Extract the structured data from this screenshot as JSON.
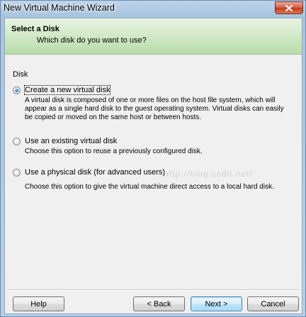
{
  "window": {
    "title": "New Virtual Machine Wizard"
  },
  "header": {
    "title": "Select a Disk",
    "subtitle": "Which disk do you want to use?"
  },
  "disk_group": {
    "label": "Disk",
    "selected": "create_new",
    "options": [
      {
        "key": "create_new",
        "label": "Create a new virtual disk",
        "description": "A virtual disk is composed of one or more files on the host file system, which will appear as a single hard disk to the guest operating system. Virtual disks can easily be copied or moved on the same host or between hosts.",
        "checked": true
      },
      {
        "key": "use_existing",
        "label": "Use an existing virtual disk",
        "description": "Choose this option to reuse a previously configured disk.",
        "checked": false
      },
      {
        "key": "use_physical",
        "label": "Use a physical disk (for advanced users)",
        "description": "Choose this option to give the virtual machine direct access to a local hard disk.",
        "checked": false
      }
    ]
  },
  "buttons": {
    "help": "Help",
    "back": "< Back",
    "next": "Next >",
    "cancel": "Cancel"
  },
  "watermark": "http://blog.csdn.net/",
  "icons": {
    "close": "close-icon"
  },
  "colors": {
    "header_gradient_top": "#e8f4e2",
    "header_gradient_bottom": "#b9dcaa",
    "radio_selected": "#1e74c1",
    "close_button": "#c03c22"
  }
}
